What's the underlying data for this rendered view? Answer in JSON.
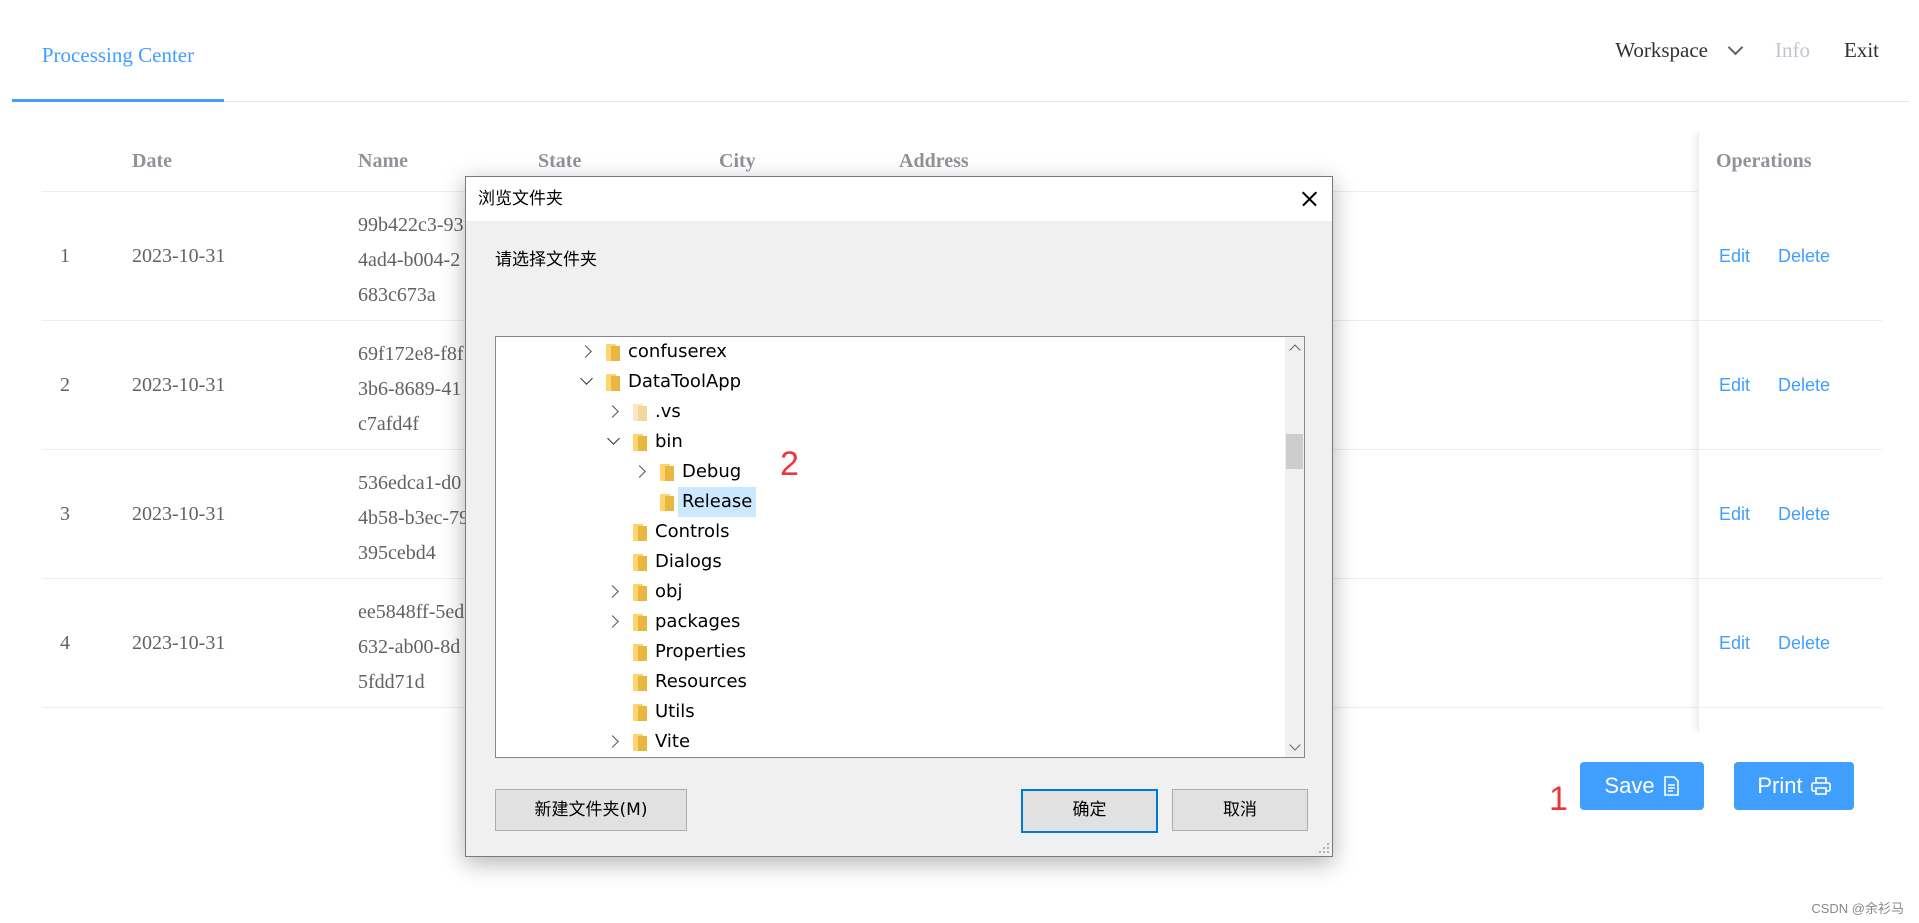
{
  "nav": {
    "active_tab": "Processing Center",
    "workspace": "Workspace",
    "info": "Info",
    "exit": "Exit"
  },
  "table": {
    "headers": {
      "index": "",
      "date": "Date",
      "name": "Name",
      "state": "State",
      "city": "City",
      "address": "Address",
      "operations": "Operations"
    },
    "rows": [
      {
        "index": "1",
        "date": "2023-10-31",
        "name": "99b422c3-93\n4ad4-b004-2\n683c673a"
      },
      {
        "index": "2",
        "date": "2023-10-31",
        "name": "69f172e8-f8f\n3b6-8689-41\nc7afd4f"
      },
      {
        "index": "3",
        "date": "2023-10-31",
        "name": "536edca1-d0\n4b58-b3ec-79\n395cebd4"
      },
      {
        "index": "4",
        "date": "2023-10-31",
        "name": "ee5848ff-5ed\n632-ab00-8d\n5fdd71d"
      }
    ],
    "edit_label": "Edit",
    "delete_label": "Delete"
  },
  "annotations": {
    "first": "1",
    "second": "2"
  },
  "footer": {
    "save_label": "Save",
    "print_label": "Print"
  },
  "watermark": "CSDN @余衫马",
  "dialog": {
    "title": "浏览文件夹",
    "prompt": "请选择文件夹",
    "tree": [
      {
        "label": "confuserex",
        "level": 0,
        "toggle": "collapsed"
      },
      {
        "label": "DataToolApp",
        "level": 0,
        "toggle": "expanded"
      },
      {
        "label": ".vs",
        "level": 1,
        "toggle": "collapsed",
        "faded": true
      },
      {
        "label": "bin",
        "level": 1,
        "toggle": "expanded"
      },
      {
        "label": "Debug",
        "level": 2,
        "toggle": "collapsed"
      },
      {
        "label": "Release",
        "level": 2,
        "toggle": "none",
        "selected": true
      },
      {
        "label": "Controls",
        "level": 1,
        "toggle": "none"
      },
      {
        "label": "Dialogs",
        "level": 1,
        "toggle": "none"
      },
      {
        "label": "obj",
        "level": 1,
        "toggle": "collapsed"
      },
      {
        "label": "packages",
        "level": 1,
        "toggle": "collapsed"
      },
      {
        "label": "Properties",
        "level": 1,
        "toggle": "none"
      },
      {
        "label": "Resources",
        "level": 1,
        "toggle": "none"
      },
      {
        "label": "Utils",
        "level": 1,
        "toggle": "none"
      },
      {
        "label": "Vite",
        "level": 1,
        "toggle": "collapsed"
      }
    ],
    "new_folder_label": "新建文件夹(M)",
    "ok_label": "确定",
    "cancel_label": "取消"
  }
}
